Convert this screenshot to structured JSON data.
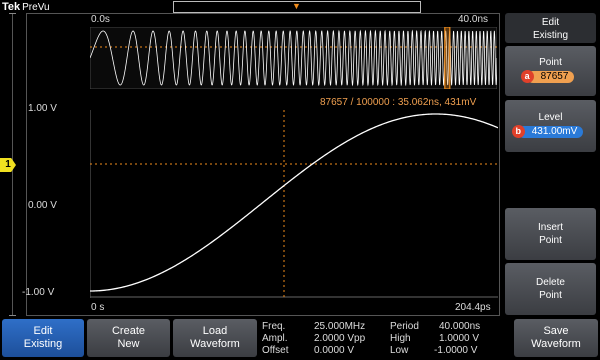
{
  "header": {
    "brand": "Tek",
    "app": "PreVu"
  },
  "overview": {
    "start_label": "0.0s",
    "end_label": "40.0ns",
    "window_fraction": 0.87657
  },
  "cursor_readout": "87657 / 100000 : 35.062ns, 431mV",
  "main": {
    "y_top": "1.00 V",
    "y_mid": "0.00 V",
    "y_bot": "-1.00 V",
    "x_start": "0 s",
    "x_end": "204.4ps",
    "channel": "1"
  },
  "side_menu": {
    "title_line1": "Edit",
    "title_line2": "Existing",
    "point_label": "Point",
    "point_badge": "a",
    "point_value": "87657",
    "level_label": "Level",
    "level_badge": "b",
    "level_value": "431.00mV",
    "insert_line1": "Insert",
    "insert_line2": "Point",
    "delete_line1": "Delete",
    "delete_line2": "Point"
  },
  "bottom": {
    "edit_line1": "Edit",
    "edit_line2": "Existing",
    "create_line1": "Create",
    "create_line2": "New",
    "load_line1": "Load",
    "load_line2": "Waveform",
    "save_line1": "Save",
    "save_line2": "Waveform"
  },
  "params": {
    "freq_label": "Freq.",
    "freq_value": "25.000MHz",
    "period_label": "Period",
    "period_value": "40.000ns",
    "ampl_label": "Ampl.",
    "ampl_value": "2.0000 Vpp",
    "high_label": "High",
    "high_value": "1.0000 V",
    "offset_label": "Offset",
    "offset_value": "0.0000 V",
    "low_label": "Low",
    "low_value": "-1.0000 V"
  },
  "colors": {
    "accent": "#2f6fc8",
    "cursor": "#f08c1c",
    "trace": "#ffffff",
    "channel": "#f0e020"
  }
}
